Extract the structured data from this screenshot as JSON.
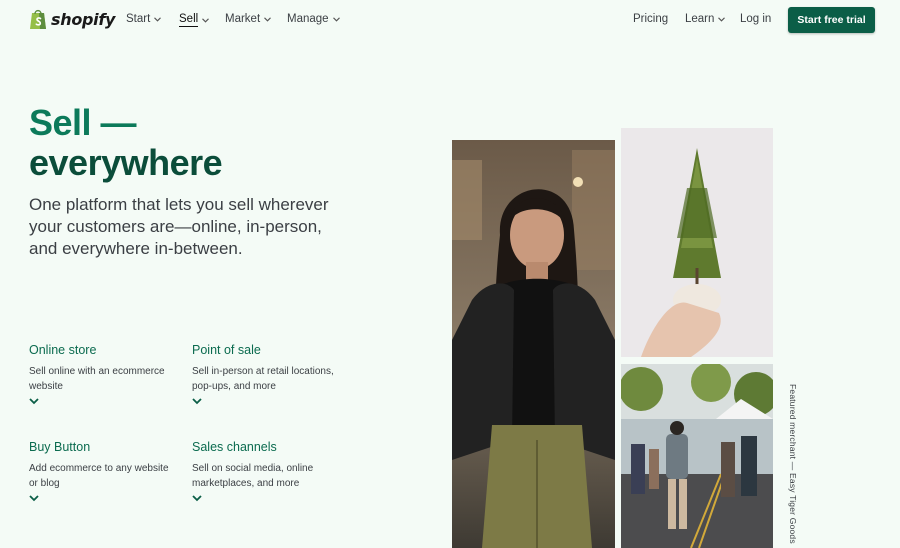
{
  "nav": {
    "brand": "shopify",
    "items": [
      {
        "label": "Start",
        "has_dropdown": true
      },
      {
        "label": "Sell",
        "has_dropdown": true,
        "active": true
      },
      {
        "label": "Market",
        "has_dropdown": true
      },
      {
        "label": "Manage",
        "has_dropdown": true
      }
    ],
    "right": [
      {
        "label": "Pricing"
      },
      {
        "label": "Learn",
        "has_dropdown": true
      },
      {
        "label": "Log in"
      }
    ],
    "cta": "Start free trial"
  },
  "hero": {
    "headline_line1": "Sell —",
    "headline_line2": "everywhere",
    "subheadline": "One platform that lets you sell wherever your customers are—online, in-person, and everywhere in-between."
  },
  "features": [
    {
      "title": "Online store",
      "description": "Sell online with an ecommerce website"
    },
    {
      "title": "Point of sale",
      "description": "Sell in-person at retail locations, pop-ups, and more"
    },
    {
      "title": "Buy Button",
      "description": "Add ecommerce to any website or blog"
    },
    {
      "title": "Sales channels",
      "description": "Sell on social media, online marketplaces, and more"
    }
  ],
  "featured_caption": "Featured merchant — Easy Tiger Goods",
  "colors": {
    "accent": "#0b5e47",
    "headline_green": "#0c7a5a",
    "background": "#f4fbf6"
  },
  "icons": [
    "shopify-bag-icon",
    "chevron-down-icon"
  ]
}
